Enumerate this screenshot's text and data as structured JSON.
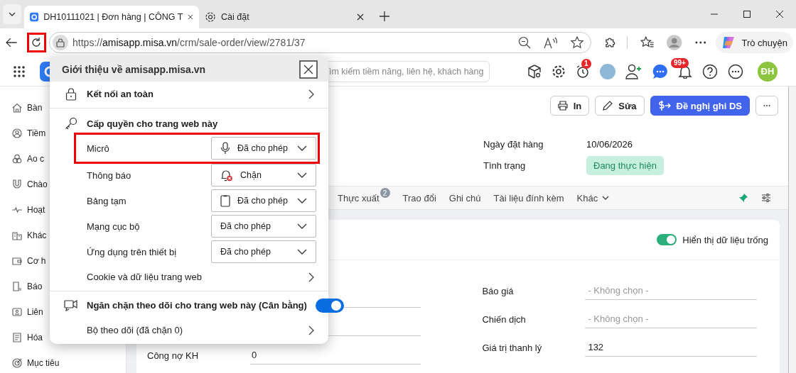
{
  "browser": {
    "tabs": [
      {
        "title": "DH10111021 | Đơn hàng | CÔNG T",
        "kind": "app",
        "selected": true
      },
      {
        "title": "Cài đặt",
        "kind": "settings",
        "selected": false
      }
    ],
    "address": {
      "scheme": "https://",
      "domain": "amisapp.misa.vn",
      "path": "/crm/sale-order/view/2781/37"
    },
    "reload_highlighted": true,
    "copilot_label": "Trò chuyện"
  },
  "app": {
    "search": {
      "placeholder": "ìm kiếm tiềm năng, liên hệ, khách hàng"
    },
    "header_badges": {
      "reminders": "1",
      "notifications": "99+"
    },
    "user_initials": "ĐH",
    "sidebar": [
      {
        "label": "Bàn",
        "kind": "home"
      },
      {
        "label": "Tiềm",
        "kind": "person"
      },
      {
        "label": "Ao c",
        "kind": "circles"
      },
      {
        "label": "Chào",
        "kind": "magnet"
      },
      {
        "label": "Hoạt",
        "kind": "pulse"
      },
      {
        "label": "Khác",
        "kind": "building"
      },
      {
        "label": "Cơ h",
        "kind": "wallet"
      },
      {
        "label": "Báo",
        "kind": "doc"
      },
      {
        "label": "Liên",
        "kind": "contact"
      },
      {
        "label": "Hóa",
        "kind": "invoice"
      },
      {
        "label": "Mục tiêu",
        "kind": "target"
      }
    ],
    "actions": [
      {
        "label": "In",
        "kind": "print"
      },
      {
        "label": "Sửa",
        "kind": "edit"
      },
      {
        "label": "Đề nghị ghi DS",
        "kind": "primary"
      },
      {
        "kind": "more"
      }
    ],
    "summary": [
      {
        "label": "Ngày đặt hàng",
        "value": "10/06/2026",
        "kind": "text"
      },
      {
        "label": "Tình trạng",
        "value": "Đang thực hiện",
        "kind": "status"
      }
    ],
    "record_tabs": [
      {
        "label": "Thực xuất",
        "badge": "2",
        "dropdown": false
      },
      {
        "label": "Trao đổi",
        "dropdown": false
      },
      {
        "label": "Ghi chú",
        "dropdown": false
      },
      {
        "label": "Tài liệu đính kèm",
        "dropdown": false
      },
      {
        "label": "Khác",
        "dropdown": true
      }
    ],
    "show_empty": {
      "label": "Hiển thị dữ liệu trống",
      "on": true
    },
    "left_fields": [
      {
        "label": "Công nợ KH",
        "value": "0"
      }
    ],
    "right_fields": [
      {
        "label": "Báo giá",
        "placeholder": "- Không chọn -"
      },
      {
        "label": "Chiến dịch",
        "placeholder": "- Không chọn -"
      },
      {
        "label": "Giá trị thanh lý",
        "value": "132"
      }
    ]
  },
  "site_info": {
    "title": "Giới thiệu về amisapp.misa.vn",
    "connection": "Kết nối an toàn",
    "permissions_heading": "Cấp quyền cho trang web này",
    "permissions": [
      {
        "label": "Micrô",
        "value": "Đã cho phép",
        "kind": "mic",
        "highlighted": true
      },
      {
        "label": "Thông báo",
        "value": "Chặn",
        "kind": "bell-blocked",
        "highlighted": false
      },
      {
        "label": "Bảng tạm",
        "value": "Đã cho phép",
        "kind": "clipboard",
        "highlighted": false
      },
      {
        "label": "Mạng cục bộ",
        "value": "Đã cho phép",
        "kind": "none",
        "highlighted": false
      },
      {
        "label": "Ứng dụng trên thiết bị",
        "value": "Đã cho phép",
        "kind": "none",
        "highlighted": false
      }
    ],
    "cookies": "Cookie và dữ liệu trang web",
    "tracking": {
      "label": "Ngăn chặn theo dõi cho trang web này (Cân bằng)",
      "on": true
    },
    "trackers": "Bộ theo dõi (đã chặn 0)"
  }
}
